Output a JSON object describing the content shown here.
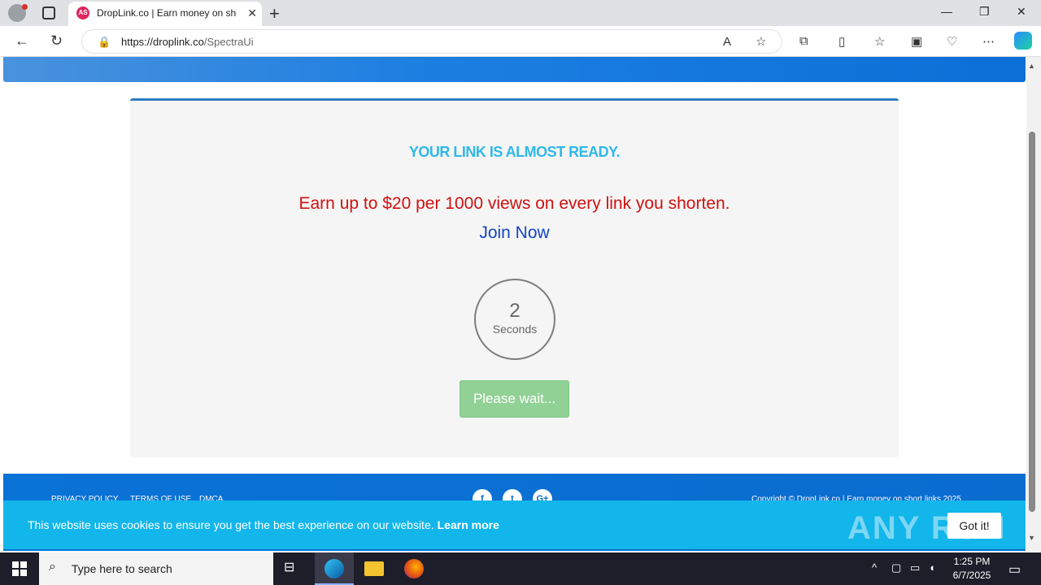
{
  "browser": {
    "tab_title": "DropLink.co | Earn money on sho",
    "favicon_text": "AS",
    "url_host": "https://droplink.co",
    "url_path": "/SpectraUi"
  },
  "page": {
    "headline": "YOUR LINK IS ALMOST READY.",
    "promo": "Earn up to $20 per 1000 views on every link you shorten.",
    "join_label": "Join Now",
    "timer_value": "2",
    "timer_unit": "Seconds",
    "wait_label": "Please wait...",
    "footer_links": [
      "PRIVACY POLICY",
      "TERMS OF USE",
      "DMCA"
    ],
    "social": [
      "f",
      "t",
      "G+"
    ],
    "copyright": "Copyright © DropLink.co | Earn money on short links 2025"
  },
  "cookie_banner": {
    "text": "This website uses cookies to ensure you get the best experience on our website.",
    "learn_more": "Learn more",
    "button": "Got it!",
    "watermark": "ANY RUN"
  },
  "taskbar": {
    "search_placeholder": "Type here to search",
    "time": "1:25 PM",
    "date": "6/7/2025"
  },
  "colors": {
    "headline": "#2fb8e8",
    "promo": "#d01111",
    "join": "#1444c2",
    "wait_button": "#92d196",
    "cookie_bar": "#12b6ea"
  }
}
